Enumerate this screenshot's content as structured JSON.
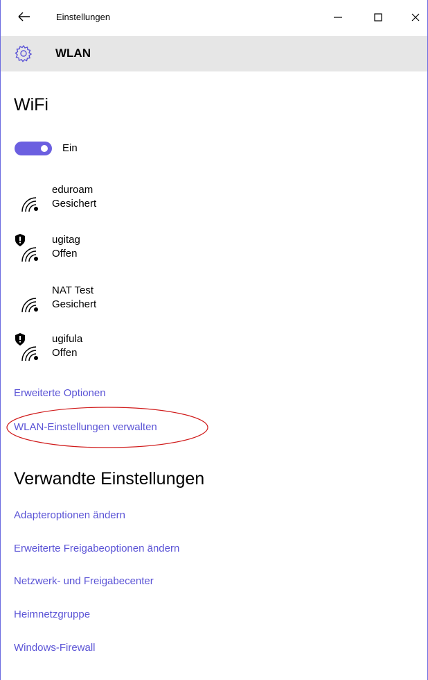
{
  "window": {
    "title": "Einstellungen",
    "controls": {
      "minimize": "—",
      "maximize": "☐",
      "close": "✕"
    }
  },
  "header": {
    "title": "WLAN"
  },
  "wifi": {
    "heading": "WiFi",
    "toggle_label": "Ein",
    "toggle_on": true,
    "networks": [
      {
        "name": "eduroam",
        "status": "Gesichert",
        "shield": false
      },
      {
        "name": "ugitag",
        "status": "Offen",
        "shield": true
      },
      {
        "name": "NAT Test",
        "status": "Gesichert",
        "shield": false
      },
      {
        "name": "ugifula",
        "status": "Offen",
        "shield": true
      }
    ],
    "links": {
      "advanced": "Erweiterte Optionen",
      "manage": "WLAN-Einstellungen verwalten"
    }
  },
  "related": {
    "heading": "Verwandte Einstellungen",
    "links": [
      "Adapteroptionen ändern",
      "Erweiterte Freigabeoptionen ändern",
      "Netzwerk- und Freigabecenter",
      "Heimnetzgruppe",
      "Windows-Firewall"
    ]
  },
  "colors": {
    "accent": "#6b5fe0",
    "link": "#5b54d6",
    "header_bg": "#e6e6e6",
    "annotation": "#d01a1a"
  }
}
